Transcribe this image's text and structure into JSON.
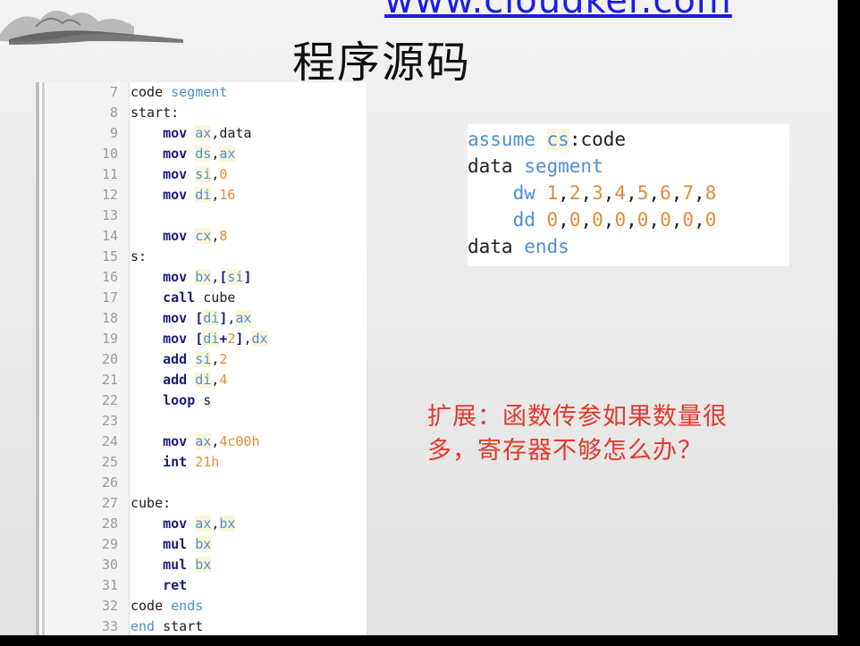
{
  "header": {
    "url": "www.cloudker.com",
    "title": "程序源码"
  },
  "editor": {
    "lines": [
      {
        "n": "7",
        "t": [
          {
            "s": "code ",
            "c": "plain"
          },
          {
            "s": "segment",
            "c": "blu"
          }
        ]
      },
      {
        "n": "8",
        "t": [
          {
            "s": "start:",
            "c": "plain"
          }
        ]
      },
      {
        "n": "9",
        "t": [
          {
            "s": "    ",
            "c": "plain"
          },
          {
            "s": "mov",
            "c": "kw"
          },
          {
            "s": " ",
            "c": "plain"
          },
          {
            "s": "ax",
            "c": "reg"
          },
          {
            "s": ",data",
            "c": "plain"
          }
        ]
      },
      {
        "n": "10",
        "t": [
          {
            "s": "    ",
            "c": "plain"
          },
          {
            "s": "mov",
            "c": "kw"
          },
          {
            "s": " ",
            "c": "plain"
          },
          {
            "s": "ds",
            "c": "reg"
          },
          {
            "s": ",",
            "c": "plain"
          },
          {
            "s": "ax",
            "c": "reg"
          }
        ]
      },
      {
        "n": "11",
        "t": [
          {
            "s": "    ",
            "c": "plain"
          },
          {
            "s": "mov",
            "c": "kw"
          },
          {
            "s": " ",
            "c": "plain"
          },
          {
            "s": "si",
            "c": "reg"
          },
          {
            "s": ",",
            "c": "plain"
          },
          {
            "s": "0",
            "c": "num"
          }
        ]
      },
      {
        "n": "12",
        "t": [
          {
            "s": "    ",
            "c": "plain"
          },
          {
            "s": "mov",
            "c": "kw"
          },
          {
            "s": " ",
            "c": "plain"
          },
          {
            "s": "di",
            "c": "reg"
          },
          {
            "s": ",",
            "c": "plain"
          },
          {
            "s": "16",
            "c": "num"
          }
        ]
      },
      {
        "n": "13",
        "t": []
      },
      {
        "n": "14",
        "t": [
          {
            "s": "    ",
            "c": "plain"
          },
          {
            "s": "mov",
            "c": "kw"
          },
          {
            "s": " ",
            "c": "plain"
          },
          {
            "s": "cx",
            "c": "reg"
          },
          {
            "s": ",",
            "c": "plain"
          },
          {
            "s": "8",
            "c": "num"
          }
        ]
      },
      {
        "n": "15",
        "t": [
          {
            "s": "s:",
            "c": "plain"
          }
        ]
      },
      {
        "n": "16",
        "t": [
          {
            "s": "    ",
            "c": "plain"
          },
          {
            "s": "mov",
            "c": "kw"
          },
          {
            "s": " ",
            "c": "plain"
          },
          {
            "s": "bx",
            "c": "reg"
          },
          {
            "s": ",",
            "c": "plain"
          },
          {
            "s": "[",
            "c": "kw"
          },
          {
            "s": "si",
            "c": "reg"
          },
          {
            "s": "]",
            "c": "kw"
          }
        ]
      },
      {
        "n": "17",
        "t": [
          {
            "s": "    ",
            "c": "plain"
          },
          {
            "s": "call",
            "c": "kw"
          },
          {
            "s": " cube",
            "c": "plain"
          }
        ]
      },
      {
        "n": "18",
        "t": [
          {
            "s": "    ",
            "c": "plain"
          },
          {
            "s": "mov",
            "c": "kw"
          },
          {
            "s": " ",
            "c": "plain"
          },
          {
            "s": "[",
            "c": "kw"
          },
          {
            "s": "di",
            "c": "reg"
          },
          {
            "s": "]",
            "c": "kw"
          },
          {
            "s": ",",
            "c": "plain"
          },
          {
            "s": "ax",
            "c": "reg"
          }
        ]
      },
      {
        "n": "19",
        "t": [
          {
            "s": "    ",
            "c": "plain"
          },
          {
            "s": "mov",
            "c": "kw"
          },
          {
            "s": " ",
            "c": "plain"
          },
          {
            "s": "[",
            "c": "kw"
          },
          {
            "s": "di",
            "c": "reg"
          },
          {
            "s": "+",
            "c": "kw"
          },
          {
            "s": "2",
            "c": "num"
          },
          {
            "s": "]",
            "c": "kw"
          },
          {
            "s": ",",
            "c": "plain"
          },
          {
            "s": "dx",
            "c": "reg"
          }
        ]
      },
      {
        "n": "20",
        "t": [
          {
            "s": "    ",
            "c": "plain"
          },
          {
            "s": "add",
            "c": "kw"
          },
          {
            "s": " ",
            "c": "plain"
          },
          {
            "s": "si",
            "c": "reg"
          },
          {
            "s": ",",
            "c": "plain"
          },
          {
            "s": "2",
            "c": "num"
          }
        ]
      },
      {
        "n": "21",
        "t": [
          {
            "s": "    ",
            "c": "plain"
          },
          {
            "s": "add",
            "c": "kw"
          },
          {
            "s": " ",
            "c": "plain"
          },
          {
            "s": "di",
            "c": "reg"
          },
          {
            "s": ",",
            "c": "plain"
          },
          {
            "s": "4",
            "c": "num"
          }
        ]
      },
      {
        "n": "22",
        "t": [
          {
            "s": "    ",
            "c": "plain"
          },
          {
            "s": "loop",
            "c": "kw"
          },
          {
            "s": " s",
            "c": "plain"
          }
        ]
      },
      {
        "n": "23",
        "t": []
      },
      {
        "n": "24",
        "t": [
          {
            "s": "    ",
            "c": "plain"
          },
          {
            "s": "mov",
            "c": "kw"
          },
          {
            "s": " ",
            "c": "plain"
          },
          {
            "s": "ax",
            "c": "reg"
          },
          {
            "s": ",",
            "c": "plain"
          },
          {
            "s": "4c00h",
            "c": "num"
          }
        ]
      },
      {
        "n": "25",
        "t": [
          {
            "s": "    ",
            "c": "plain"
          },
          {
            "s": "int",
            "c": "kw"
          },
          {
            "s": " ",
            "c": "plain"
          },
          {
            "s": "21h",
            "c": "num"
          }
        ]
      },
      {
        "n": "26",
        "t": []
      },
      {
        "n": "27",
        "t": [
          {
            "s": "cube:",
            "c": "plain"
          }
        ]
      },
      {
        "n": "28",
        "t": [
          {
            "s": "    ",
            "c": "plain"
          },
          {
            "s": "mov",
            "c": "kw"
          },
          {
            "s": " ",
            "c": "plain"
          },
          {
            "s": "ax",
            "c": "reg"
          },
          {
            "s": ",",
            "c": "plain"
          },
          {
            "s": "bx",
            "c": "reg"
          }
        ]
      },
      {
        "n": "29",
        "t": [
          {
            "s": "    ",
            "c": "plain"
          },
          {
            "s": "mul",
            "c": "kw"
          },
          {
            "s": " ",
            "c": "plain"
          },
          {
            "s": "bx",
            "c": "reg"
          }
        ]
      },
      {
        "n": "30",
        "t": [
          {
            "s": "    ",
            "c": "plain"
          },
          {
            "s": "mul",
            "c": "kw"
          },
          {
            "s": " ",
            "c": "plain"
          },
          {
            "s": "bx",
            "c": "reg"
          }
        ]
      },
      {
        "n": "31",
        "t": [
          {
            "s": "    ",
            "c": "plain"
          },
          {
            "s": "ret",
            "c": "kw"
          }
        ]
      },
      {
        "n": "32",
        "t": [
          {
            "s": "code ",
            "c": "plain"
          },
          {
            "s": "ends",
            "c": "blu"
          }
        ]
      },
      {
        "n": "33",
        "t": [
          {
            "s": "end",
            "c": "blu"
          },
          {
            "s": " start",
            "c": "plain"
          }
        ]
      }
    ]
  },
  "data_box": {
    "lines": [
      [
        {
          "s": "assume ",
          "c": "blu"
        },
        {
          "s": "cs",
          "c": "reg"
        },
        {
          "s": ":code",
          "c": "plain"
        }
      ],
      [
        {
          "s": "data ",
          "c": "plain"
        },
        {
          "s": "segment",
          "c": "blu"
        }
      ],
      [
        {
          "s": "    ",
          "c": "plain"
        },
        {
          "s": "dw ",
          "c": "blu"
        },
        {
          "s": "1",
          "c": "num"
        },
        {
          "s": ",",
          "c": "plain"
        },
        {
          "s": "2",
          "c": "num"
        },
        {
          "s": ",",
          "c": "plain"
        },
        {
          "s": "3",
          "c": "num"
        },
        {
          "s": ",",
          "c": "plain"
        },
        {
          "s": "4",
          "c": "num"
        },
        {
          "s": ",",
          "c": "plain"
        },
        {
          "s": "5",
          "c": "num"
        },
        {
          "s": ",",
          "c": "plain"
        },
        {
          "s": "6",
          "c": "num"
        },
        {
          "s": ",",
          "c": "plain"
        },
        {
          "s": "7",
          "c": "num"
        },
        {
          "s": ",",
          "c": "plain"
        },
        {
          "s": "8",
          "c": "num"
        }
      ],
      [
        {
          "s": "    ",
          "c": "plain"
        },
        {
          "s": "dd ",
          "c": "blu"
        },
        {
          "s": "0",
          "c": "num"
        },
        {
          "s": ",",
          "c": "plain"
        },
        {
          "s": "0",
          "c": "num"
        },
        {
          "s": ",",
          "c": "plain"
        },
        {
          "s": "0",
          "c": "num"
        },
        {
          "s": ",",
          "c": "plain"
        },
        {
          "s": "0",
          "c": "num"
        },
        {
          "s": ",",
          "c": "plain"
        },
        {
          "s": "0",
          "c": "num"
        },
        {
          "s": ",",
          "c": "plain"
        },
        {
          "s": "0",
          "c": "num"
        },
        {
          "s": ",",
          "c": "plain"
        },
        {
          "s": "0",
          "c": "num"
        },
        {
          "s": ",",
          "c": "plain"
        },
        {
          "s": "0",
          "c": "num"
        }
      ],
      [
        {
          "s": "data ",
          "c": "plain"
        },
        {
          "s": "ends",
          "c": "blu"
        }
      ]
    ]
  },
  "note": {
    "line1": "扩展：函数传参如果数量很",
    "line2": "多，寄存器不够怎么办？"
  },
  "colors": {
    "keyword": "#1b1b80",
    "register": "#4d8fd6",
    "number": "#e68a38",
    "note": "#e03a2e",
    "url": "#1a1af0"
  }
}
